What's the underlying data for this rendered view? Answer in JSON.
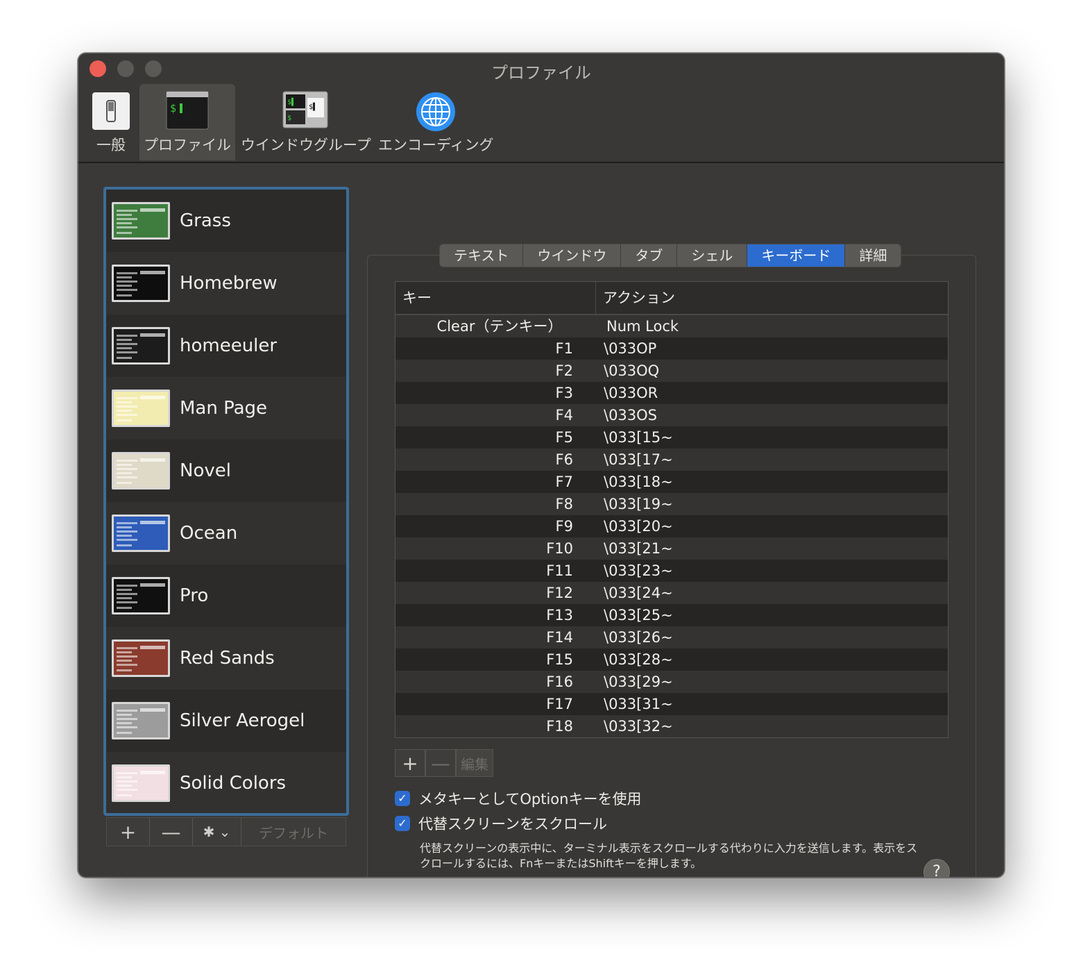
{
  "window": {
    "title": "プロファイル"
  },
  "toolbar": [
    {
      "label": "一般",
      "icon": "switch-icon"
    },
    {
      "label": "プロファイル",
      "icon": "terminal-icon"
    },
    {
      "label": "ウインドウグループ",
      "icon": "window-group-icon"
    },
    {
      "label": "エンコーディング",
      "icon": "globe-icon"
    }
  ],
  "profiles": [
    {
      "name": "Grass",
      "color": "#3e7d3e"
    },
    {
      "name": "Homebrew",
      "color": "#0e0e0e"
    },
    {
      "name": "homeeuler",
      "color": "#1c1c1c"
    },
    {
      "name": "Man Page",
      "color": "#f3ecb0"
    },
    {
      "name": "Novel",
      "color": "#dfd9c7"
    },
    {
      "name": "Ocean",
      "color": "#2e5cb8"
    },
    {
      "name": "Pro",
      "color": "#101010"
    },
    {
      "name": "Red Sands",
      "color": "#8a3b2e"
    },
    {
      "name": "Silver Aerogel",
      "color": "#9c9c9c"
    },
    {
      "name": "Solid Colors",
      "color": "#f2dfe4"
    }
  ],
  "profile_buttons": {
    "add": "+",
    "remove": "—",
    "gear": "✱ ⌄",
    "default": "デフォルト"
  },
  "tabs": [
    "テキスト",
    "ウインドウ",
    "タブ",
    "シェル",
    "キーボード",
    "詳細"
  ],
  "active_tab": "キーボード",
  "table": {
    "headers": {
      "key": "キー",
      "action": "アクション"
    },
    "rows": [
      {
        "key": "Clear（テンキー）",
        "action": "Num Lock"
      },
      {
        "key": "F1",
        "action": "\\033OP"
      },
      {
        "key": "F2",
        "action": "\\033OQ"
      },
      {
        "key": "F3",
        "action": "\\033OR"
      },
      {
        "key": "F4",
        "action": "\\033OS"
      },
      {
        "key": "F5",
        "action": "\\033[15~"
      },
      {
        "key": "F6",
        "action": "\\033[17~"
      },
      {
        "key": "F7",
        "action": "\\033[18~"
      },
      {
        "key": "F8",
        "action": "\\033[19~"
      },
      {
        "key": "F9",
        "action": "\\033[20~"
      },
      {
        "key": "F10",
        "action": "\\033[21~"
      },
      {
        "key": "F11",
        "action": "\\033[23~"
      },
      {
        "key": "F12",
        "action": "\\033[24~"
      },
      {
        "key": "F13",
        "action": "\\033[25~"
      },
      {
        "key": "F14",
        "action": "\\033[26~"
      },
      {
        "key": "F15",
        "action": "\\033[28~"
      },
      {
        "key": "F16",
        "action": "\\033[29~"
      },
      {
        "key": "F17",
        "action": "\\033[31~"
      },
      {
        "key": "F18",
        "action": "\\033[32~"
      }
    ]
  },
  "table_buttons": {
    "add": "+",
    "remove": "—",
    "edit": "編集"
  },
  "options": {
    "option_as_meta": {
      "label": "メタキーとしてOptionキーを使用",
      "checked": true
    },
    "scroll_alternate": {
      "label": "代替スクリーンをスクロール",
      "checked": true
    },
    "description": "代替スクリーンの表示中に、ターミナル表示をスクロールする代わりに入力を送信します。表示をスクロールするには、FnキーまたはShiftキーを押します。"
  },
  "help_label": "?",
  "colors": {
    "accent": "#2d6ccf",
    "close": "#ed5e55",
    "selection_border": "#3d6d99"
  }
}
